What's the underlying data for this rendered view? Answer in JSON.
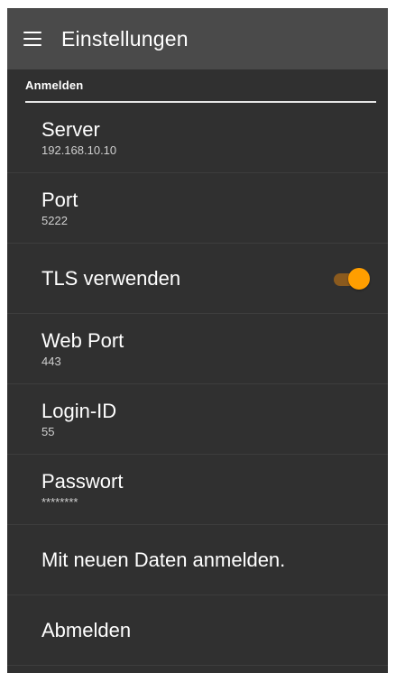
{
  "appbar": {
    "title": "Einstellungen",
    "menu_icon": "hamburger-menu-icon"
  },
  "section": {
    "title": "Anmelden"
  },
  "prefs": {
    "server": {
      "title": "Server",
      "summary": "192.168.10.10"
    },
    "port": {
      "title": "Port",
      "summary": "5222"
    },
    "tls": {
      "title": "TLS verwenden",
      "checked": true
    },
    "web_port": {
      "title": "Web Port",
      "summary": "443"
    },
    "login_id": {
      "title": "Login-ID",
      "summary": "55"
    },
    "password": {
      "title": "Passwort",
      "summary": "********"
    },
    "relogin": {
      "title": "Mit neuen Daten anmelden."
    },
    "logout": {
      "title": "Abmelden"
    }
  },
  "colors": {
    "background": "#303030",
    "appbar": "#4a4a4a",
    "accent": "#ff9e00",
    "switch_track": "#8a5a1e"
  }
}
